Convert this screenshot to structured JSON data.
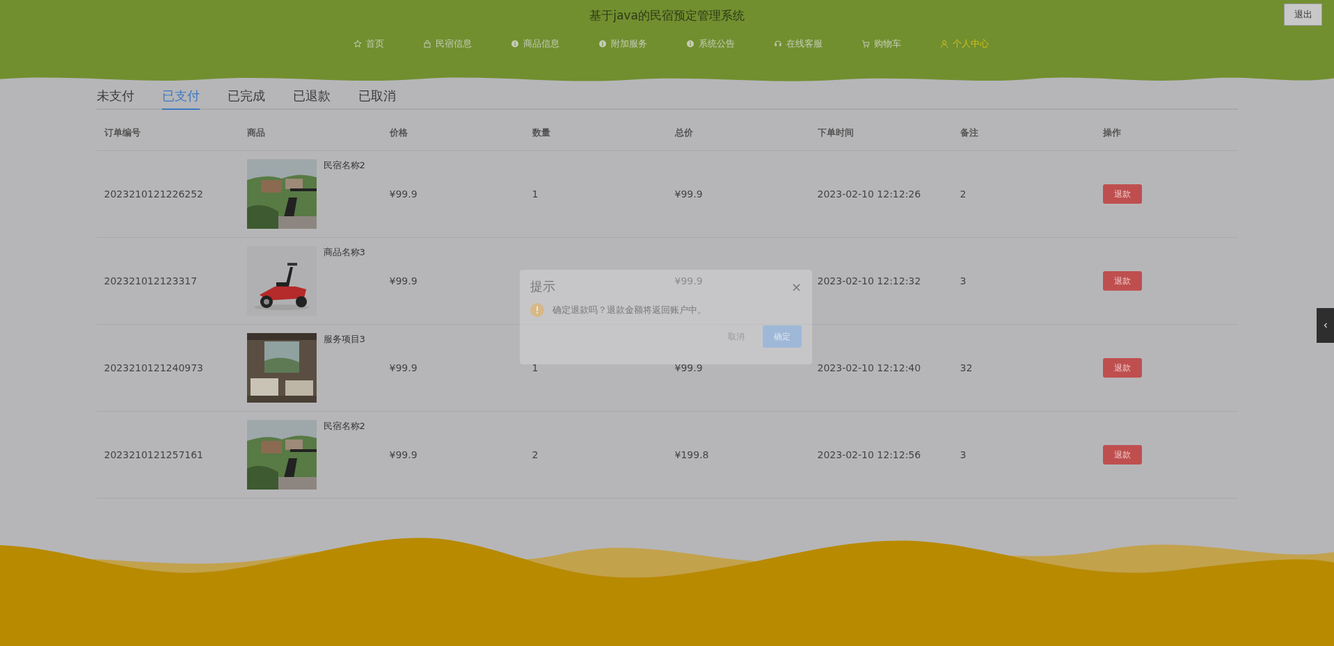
{
  "header": {
    "title": "基于java的民宿预定管理系统",
    "logout": "退出"
  },
  "nav": [
    {
      "label": "首页",
      "kind": "star",
      "selected": false
    },
    {
      "label": "民宿信息",
      "kind": "bag",
      "selected": false
    },
    {
      "label": "商品信息",
      "kind": "info",
      "selected": false
    },
    {
      "label": "附加服务",
      "kind": "help",
      "selected": false
    },
    {
      "label": "系统公告",
      "kind": "info",
      "selected": false
    },
    {
      "label": "在线客服",
      "kind": "headset",
      "selected": false
    },
    {
      "label": "购物车",
      "kind": "cart",
      "selected": false
    },
    {
      "label": "个人中心",
      "kind": "user",
      "selected": true
    }
  ],
  "tabs": [
    {
      "label": "未支付",
      "selected": false
    },
    {
      "label": "已支付",
      "selected": true
    },
    {
      "label": "已完成",
      "selected": false
    },
    {
      "label": "已退款",
      "selected": false
    },
    {
      "label": "已取消",
      "selected": false
    }
  ],
  "table": {
    "columns": [
      "订单编号",
      "商品",
      "价格",
      "数量",
      "总价",
      "下单时间",
      "备注",
      "操作"
    ],
    "rows": [
      {
        "order_no": "2023210121226252",
        "product": "民宿名称2",
        "price": "¥99.9",
        "quantity": "1",
        "total": "¥99.9",
        "time": "2023-02-10 12:12:26",
        "note": "2",
        "action": "退款"
      },
      {
        "order_no": "202321012123317",
        "product": "商品名称3",
        "price": "¥99.9",
        "total": "¥99.9",
        "time": "2023-02-10 12:12:32",
        "note": "3",
        "action": "退款"
      },
      {
        "order_no": "2023210121240973",
        "product": "服务项目3",
        "price": "¥99.9",
        "quantity": "1",
        "total": "¥99.9",
        "time": "2023-02-10 12:12:40",
        "note": "32",
        "action": "退款"
      },
      {
        "order_no": "2023210121257161",
        "product": "民宿名称2",
        "price": "¥99.9",
        "quantity": "2",
        "total": "¥199.8",
        "time": "2023-02-10 12:12:56",
        "note": "3",
        "action": "退款"
      }
    ]
  },
  "dialog": {
    "title": "提示",
    "message": "确定退款吗？退款金额将返回账户中。",
    "close": "×",
    "cancel": "取消",
    "confirm": "确定"
  }
}
